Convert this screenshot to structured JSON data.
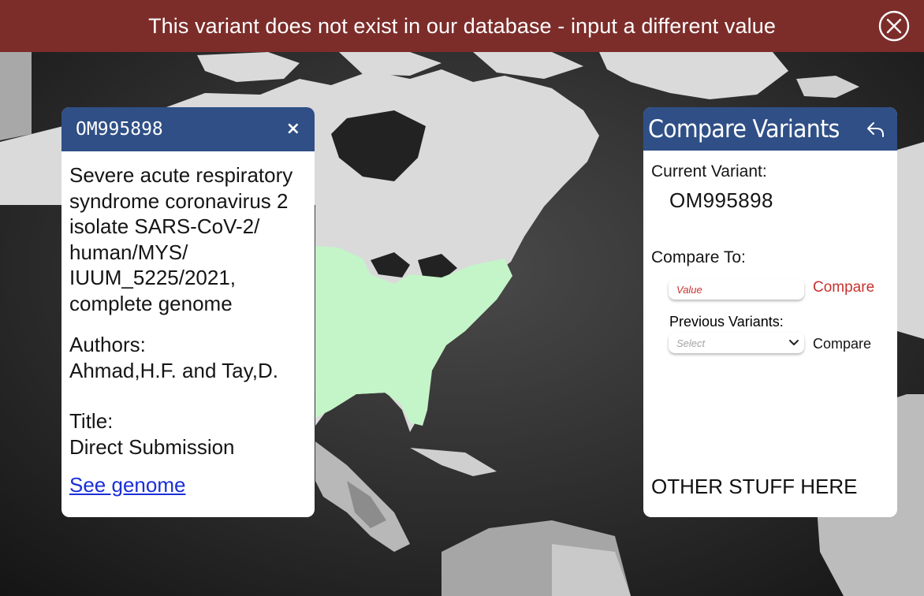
{
  "banner": {
    "message": "This variant does not exist in our database - input a different value",
    "background": "#7c2d2a",
    "close_icon": "circle-x-icon"
  },
  "map": {
    "highlight_color": "#c4f5c8",
    "background_color": "#1e1e1e",
    "land_color": "#d9d9d9"
  },
  "info": {
    "id": "OM995898",
    "close_symbol": "×",
    "description": "Severe acute respiratory\nsyndrome coronavirus 2\nisolate SARS-CoV-2/\nhuman/MYS/\nIUUM_5225/2021,\ncomplete genome",
    "authors_label": "Authors:",
    "authors_value": "Ahmad,H.F. and Tay,D.",
    "title_label": "Title:",
    "title_value": "Direct Submission",
    "link": "See genome",
    "header_color": "#2f4f86"
  },
  "compare": {
    "title": "Compare Variants",
    "back_icon": "reply-icon",
    "current_label": "Current Variant:",
    "current_value": "OM995898",
    "compare_to_label": "Compare To:",
    "value_placeholder": "Value",
    "compare_button_1": "Compare",
    "previous_label": "Previous Variants:",
    "select_placeholder": "Select",
    "compare_button_2": "Compare",
    "other": "OTHER STUFF HERE",
    "accent_color": "#c8322f"
  }
}
